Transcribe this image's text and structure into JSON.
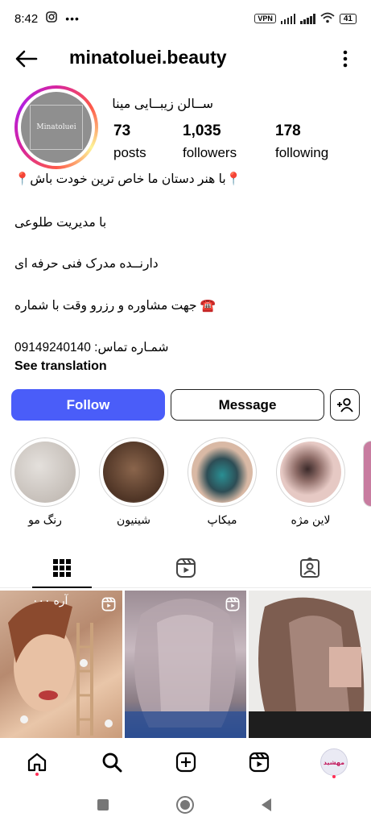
{
  "status_bar": {
    "time": "8:42",
    "vpn": "VPN",
    "battery": "41",
    "icons": [
      "instagram-icon",
      "more-dots-icon",
      "signal-icon",
      "signal-icon",
      "wifi-icon",
      "battery-icon"
    ]
  },
  "header": {
    "username": "minatoluei.beauty",
    "back_icon": "back-arrow-icon",
    "more_icon": "more-vertical-icon"
  },
  "profile": {
    "avatar_logo_text": "Minatoluei",
    "display_name": "ســالن زیبــایی مینا",
    "stats": [
      {
        "value": "73",
        "label": "posts"
      },
      {
        "value": "1,035",
        "label": "followers"
      },
      {
        "value": "178",
        "label": "following"
      }
    ],
    "bio": [
      "📍با هنر دستان ما خاص ترین خودت باش📍",
      "با مدیریت طلوعی",
      "دارنــده مدرک فنی حرفه ای",
      "☎️ جهت مشاوره و رزرو وقت با شماره",
      "شمـاره تماس: 09149240140"
    ],
    "see_translation": "See translation"
  },
  "actions": {
    "follow": "Follow",
    "message": "Message",
    "add_user_icon": "add-user-icon"
  },
  "highlights": [
    {
      "label": "رنگ مو",
      "color": "#c9c3bd"
    },
    {
      "label": "شینیون",
      "color": "#6b4a38"
    },
    {
      "label": "میکاپ",
      "color": "#3d6f75"
    },
    {
      "label": "لاین مژه",
      "color": "#d9b8b4"
    }
  ],
  "tabs": [
    "grid-icon",
    "reels-icon",
    "tagged-icon"
  ],
  "posts": [
    {
      "caption": "آره ٠٠٠",
      "type": "reel",
      "color": "#b9967a"
    },
    {
      "caption": "",
      "type": "reel",
      "color": "#a5939b"
    },
    {
      "caption": "",
      "type": "image",
      "color": "#8a7064"
    }
  ],
  "bottom_nav": [
    "home-icon",
    "search-icon",
    "new-post-icon",
    "reels-icon",
    "profile-avatar"
  ],
  "profile_avatar_text": "مهشید",
  "system_nav": [
    "recents-icon",
    "home-circle-icon",
    "back-triangle-icon"
  ]
}
